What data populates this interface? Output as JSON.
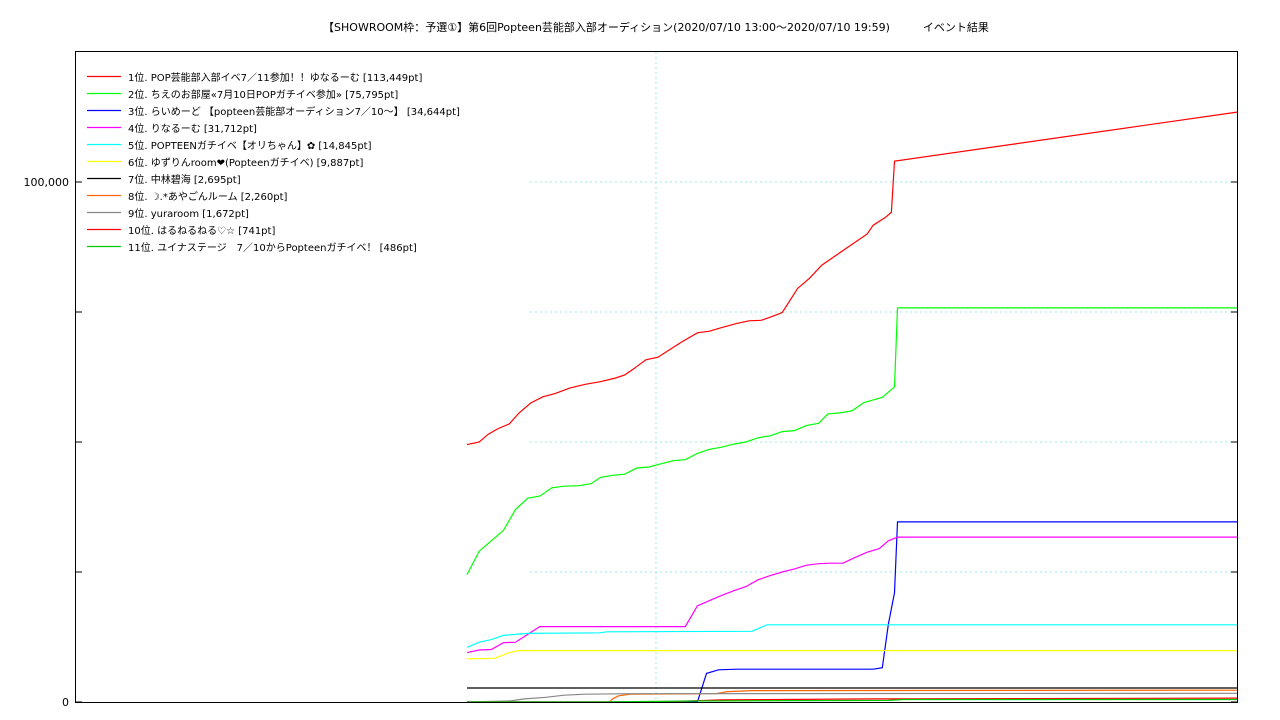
{
  "chart_data": {
    "type": "line",
    "title": "【SHOWROOM枠：予選①】第6回Popteen芸能部入部オーディション(2020/07/10 13:00～2020/07/10 19:59)　　　イベント結果",
    "xlabel": "",
    "ylabel": "",
    "x_unit": "minutes from 2020/07/10 13:00",
    "xlim": [
      -346,
      420
    ],
    "ylim": [
      0,
      125000
    ],
    "y_ticks": [
      0,
      100000
    ],
    "y_tick_labels": [
      "0",
      "100,000"
    ],
    "grid": true,
    "legend_position": "top-left",
    "series": [
      {
        "name": "1位. POP芸能部入部イベ7／11参加！！ゆなるーむ [113,449pt]",
        "color": "#ff0000",
        "points": [
          [
            -88,
            49500
          ],
          [
            -80,
            50000
          ],
          [
            -74,
            51500
          ],
          [
            -68,
            52500
          ],
          [
            -60,
            53500
          ],
          [
            -54,
            55500
          ],
          [
            -46,
            57500
          ],
          [
            -38,
            58700
          ],
          [
            -30,
            59300
          ],
          [
            -20,
            60400
          ],
          [
            -10,
            61100
          ],
          [
            0,
            61600
          ],
          [
            10,
            62300
          ],
          [
            16,
            62900
          ],
          [
            22,
            64100
          ],
          [
            30,
            65800
          ],
          [
            38,
            66300
          ],
          [
            46,
            67800
          ],
          [
            54,
            69300
          ],
          [
            64,
            71000
          ],
          [
            72,
            71300
          ],
          [
            80,
            72000
          ],
          [
            90,
            72800
          ],
          [
            98,
            73300
          ],
          [
            106,
            73400
          ],
          [
            112,
            74000
          ],
          [
            120,
            74900
          ],
          [
            130,
            79500
          ],
          [
            138,
            81500
          ],
          [
            146,
            84000
          ],
          [
            156,
            86000
          ],
          [
            166,
            88000
          ],
          [
            176,
            90000
          ],
          [
            180,
            91700
          ],
          [
            188,
            93200
          ],
          [
            192,
            94200
          ],
          [
            194,
            104000
          ],
          [
            420,
            113449
          ]
        ]
      },
      {
        "name": "2位. ちえのお部屋«7月10日POPガチイベ参加» [75,795pt]",
        "color": "#00ff00",
        "points": [
          [
            -88,
            24500
          ],
          [
            -80,
            29000
          ],
          [
            -72,
            31000
          ],
          [
            -64,
            33000
          ],
          [
            -56,
            37000
          ],
          [
            -48,
            39200
          ],
          [
            -40,
            39600
          ],
          [
            -32,
            41200
          ],
          [
            -24,
            41500
          ],
          [
            -14,
            41600
          ],
          [
            -6,
            42000
          ],
          [
            0,
            43200
          ],
          [
            8,
            43600
          ],
          [
            16,
            43800
          ],
          [
            24,
            45000
          ],
          [
            32,
            45200
          ],
          [
            40,
            45800
          ],
          [
            48,
            46400
          ],
          [
            56,
            46600
          ],
          [
            64,
            47800
          ],
          [
            72,
            48600
          ],
          [
            80,
            49000
          ],
          [
            88,
            49600
          ],
          [
            96,
            50000
          ],
          [
            104,
            50800
          ],
          [
            112,
            51200
          ],
          [
            120,
            52000
          ],
          [
            128,
            52200
          ],
          [
            136,
            53200
          ],
          [
            144,
            53600
          ],
          [
            150,
            55400
          ],
          [
            158,
            55600
          ],
          [
            166,
            56000
          ],
          [
            174,
            57600
          ],
          [
            180,
            58100
          ],
          [
            186,
            58600
          ],
          [
            190,
            59600
          ],
          [
            194,
            60600
          ],
          [
            196,
            75795
          ],
          [
            420,
            75795
          ]
        ]
      },
      {
        "name": "3位. らいめーど 【popteen芸能部オーディション7／10～】 [34,644pt]",
        "color": "#0000ff",
        "points": [
          [
            -88,
            0
          ],
          [
            60,
            0
          ],
          [
            64,
            0
          ],
          [
            70,
            5500
          ],
          [
            78,
            6200
          ],
          [
            90,
            6300
          ],
          [
            180,
            6300
          ],
          [
            186,
            6600
          ],
          [
            190,
            15000
          ],
          [
            194,
            21000
          ],
          [
            196,
            34644
          ],
          [
            420,
            34644
          ]
        ]
      },
      {
        "name": "4位. りなるーむ [31,712pt]",
        "color": "#ff00ff",
        "points": [
          [
            -88,
            9500
          ],
          [
            -80,
            10000
          ],
          [
            -72,
            10100
          ],
          [
            -64,
            11400
          ],
          [
            -56,
            11500
          ],
          [
            -48,
            13000
          ],
          [
            -40,
            14500
          ],
          [
            0,
            14500
          ],
          [
            40,
            14500
          ],
          [
            50,
            14500
          ],
          [
            56,
            14500
          ],
          [
            64,
            18500
          ],
          [
            72,
            19500
          ],
          [
            80,
            20500
          ],
          [
            88,
            21400
          ],
          [
            96,
            22200
          ],
          [
            104,
            23500
          ],
          [
            112,
            24300
          ],
          [
            120,
            25000
          ],
          [
            128,
            25600
          ],
          [
            136,
            26300
          ],
          [
            144,
            26600
          ],
          [
            152,
            26700
          ],
          [
            160,
            26700
          ],
          [
            168,
            27800
          ],
          [
            176,
            28800
          ],
          [
            184,
            29500
          ],
          [
            190,
            31000
          ],
          [
            196,
            31712
          ],
          [
            420,
            31712
          ]
        ]
      },
      {
        "name": "5位. POPTEENガチイベ【オリちゃん】✿ [14,845pt]",
        "color": "#00ffff",
        "points": [
          [
            -88,
            10500
          ],
          [
            -80,
            11500
          ],
          [
            -72,
            12000
          ],
          [
            -64,
            12800
          ],
          [
            -56,
            13000
          ],
          [
            -48,
            13200
          ],
          [
            0,
            13300
          ],
          [
            4,
            13500
          ],
          [
            100,
            13600
          ],
          [
            110,
            14845
          ],
          [
            420,
            14845
          ]
        ]
      },
      {
        "name": "6位. ゆずりんroom❤︎(Popteenガチイベ) [9,887pt]",
        "color": "#ffff00",
        "points": [
          [
            -88,
            8300
          ],
          [
            -70,
            8400
          ],
          [
            -60,
            9500
          ],
          [
            -54,
            9887
          ],
          [
            420,
            9887
          ]
        ]
      },
      {
        "name": "7位. 中林碧海 [2,695pt]",
        "color": "#000000",
        "points": [
          [
            -88,
            2695
          ],
          [
            420,
            2695
          ]
        ]
      },
      {
        "name": "8位. ☽.*あやごんルーム [2,260pt]",
        "color": "#ff6600",
        "points": [
          [
            -88,
            0
          ],
          [
            6,
            0
          ],
          [
            8,
            600
          ],
          [
            12,
            1200
          ],
          [
            20,
            1500
          ],
          [
            76,
            1600
          ],
          [
            84,
            2000
          ],
          [
            100,
            2200
          ],
          [
            420,
            2260
          ]
        ]
      },
      {
        "name": "9位. yuraroom [1,672pt]",
        "color": "#888888",
        "points": [
          [
            -88,
            0
          ],
          [
            -60,
            200
          ],
          [
            -50,
            600
          ],
          [
            -36,
            900
          ],
          [
            -24,
            1300
          ],
          [
            -10,
            1500
          ],
          [
            20,
            1600
          ],
          [
            420,
            1672
          ]
        ]
      },
      {
        "name": "10位. はるねるねる♡☆ [741pt]",
        "color": "#ff0000",
        "points": [
          [
            -88,
            0
          ],
          [
            40,
            0
          ],
          [
            80,
            400
          ],
          [
            180,
            600
          ],
          [
            420,
            741
          ]
        ]
      },
      {
        "name": "11位. ユイナステージ　7／10からPopteenガチイベ！ [486pt]",
        "color": "#00cc00",
        "points": [
          [
            -88,
            0
          ],
          [
            0,
            0
          ],
          [
            60,
            200
          ],
          [
            190,
            300
          ],
          [
            200,
            486
          ],
          [
            420,
            486
          ]
        ]
      }
    ]
  }
}
